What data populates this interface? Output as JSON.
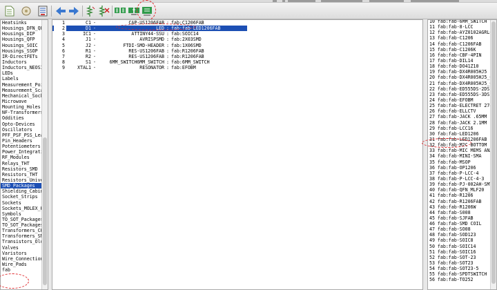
{
  "colors": {
    "selection": "#1c4fb4",
    "annotation": "#e0282c",
    "toolbar": "#e4e4e4"
  },
  "toolbar": {
    "icons": [
      "new-icon",
      "open-icon",
      "library-icon",
      "back-arrow-icon",
      "forward-arrow-icon",
      "resistor-add-icon",
      "resistor-remove-icon",
      "network-icon",
      "replace-icon",
      "library-use-icon"
    ]
  },
  "left_list": {
    "items": [
      "Heatsinks",
      "Housings_DFN_QFN",
      "Housings_DIP",
      "Housings_QFP",
      "Housings_SOIC",
      "Housings_SSOP",
      "IR-DirectFETs",
      "Inductors",
      "Inductors_NEOSID",
      "LEDs",
      "Labels",
      "Measurement_Poin",
      "Measurement_Scal",
      "Mechanical_Socke",
      "Microwave",
      "Mounting_Holes",
      "NF-Transformers",
      "Oddities",
      "Opto-Devices",
      "Oscillators",
      "PFF_PSF_PSS_Lea",
      "Pin_Headers",
      "Potentiometers",
      "Power_Integratio",
      "RF_Modules",
      "Relays_THT",
      "Resistors_SMD",
      "Resistors_THT",
      "Resistors_Univer",
      "SMD_Packages",
      "Shielding_Cabine",
      "Socket_Strips",
      "Sockets",
      "Sockets_MOLEX_KK",
      "Symbols",
      "TO_SOT_Packages",
      "TO_SOT_Packages",
      "Transformers_CHK",
      "Transformers_SMD",
      "Transistors_OldS",
      "Valves",
      "Varistors",
      "Wire_Connections",
      "Wire_Pads",
      "fab"
    ]
  },
  "components": [
    {
      "num": "1",
      "name": "C1",
      "value": "CAP-US1206FAB",
      "footprint": "fab:C1206FAB"
    },
    {
      "num": "2",
      "name": "D1",
      "value": "LED",
      "footprint": "fab:fab-LED1206FAB"
    },
    {
      "num": "3",
      "name": "IC1",
      "value": "ATTINY44-SSU",
      "footprint": "fab:SOIC14"
    },
    {
      "num": "4",
      "name": "J1",
      "value": "AVRISPSMD",
      "footprint": "fab:2X03SMD"
    },
    {
      "num": "5",
      "name": "J2",
      "value": "FTDI-SMD-HEADER",
      "footprint": "fab:1X06SMD"
    },
    {
      "num": "6",
      "name": "R1",
      "value": "RES-US1206FAB",
      "footprint": "fab:R1206FAB"
    },
    {
      "num": "7",
      "name": "R2",
      "value": "RES-US1206FAB",
      "footprint": "fab:R1206FAB"
    },
    {
      "num": "8",
      "name": "S1",
      "value": "6MM_SWITCH6MM_SWITCH",
      "footprint": "fab:6MM_SWITCH"
    },
    {
      "num": "9",
      "name": "XTAL1",
      "value": "RESONATOR",
      "footprint": "fab:EFOBM"
    }
  ],
  "footprints": {
    "items": [
      "10 fab:fab-6MM_SWITCH",
      "11 fab:fab-8-LCC",
      "12 fab:fab-AYZ0102AGRLC",
      "13 fab:fab-C1206",
      "14 fab:fab-C1206FAB",
      "15 fab:fab-C1206K",
      "16 fab:fab-CBF-4PIN",
      "17 fab:fab-DIL14",
      "18 fab:fab-DO41Z10",
      "19 fab:fab-DX4R005HJ5",
      "20 fab:fab-DX4R005HJ5_6",
      "21 fab:fab-DX4R005HJ5_6",
      "22 fab:fab-ED555DS-2DS",
      "23 fab:fab-ED555DS-3DS",
      "24 fab:fab-EFOBM",
      "25 fab:fab-ELECTRET 274",
      "26 fab:fab-ELLCTV",
      "27 fab:fab-JACK .65MM",
      "28 fab:fab-JACK 2.1MM",
      "29 fab:fab-LCC16",
      "30 fab:fab-LED1206",
      "31 fab:fab-LED1206FAB",
      "32 fab:fab-M2C BOTTOM P",
      "33 fab:fab-MIC MEMS ANA",
      "34 fab:fab-MINI-SMA",
      "35 fab:fab-MSOP",
      "36 fab:fab-OP1206",
      "37 fab:fab-P-LCC-4",
      "38 fab:fab-P-LCC-4-3",
      "39 fab:fab-PJ-002AH-SMT",
      "40 fab:fab-QFN_MLF20",
      "41 fab:fab-R1206",
      "42 fab:fab-R1206FAB",
      "43 fab:fab-R1206W",
      "44 fab:fab-S008",
      "45 fab:fab-SJFAB",
      "46 fab:fab-SMD COIL",
      "47 fab:fab-SO08",
      "48 fab:fab-SOD123",
      "49 fab:fab-SOIC8",
      "50 fab:fab-SOIC14",
      "51 fab:fab-SOIC16",
      "52 fab:fab-SOT-23",
      "53 fab:fab-SOT23",
      "54 fab:fab-SOT23-5",
      "55 fab:fab-SPDTSWITCH",
      "56 fab:fab-TO252"
    ]
  }
}
